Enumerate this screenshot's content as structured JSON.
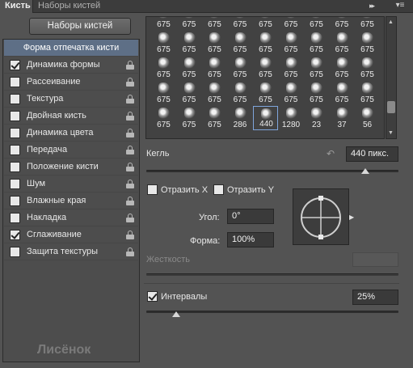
{
  "tabs": {
    "brush": "Кисть",
    "brush_sets": "Наборы кистей"
  },
  "collapse_glyph": "▸▸",
  "menu_glyph": "▾≡",
  "sets_button": "Наборы кистей",
  "left_panel": {
    "header": "Форма отпечатка кисти",
    "items": [
      {
        "label": "Динамика формы",
        "checked": true
      },
      {
        "label": "Рассеивание",
        "checked": false
      },
      {
        "label": "Текстура",
        "checked": false
      },
      {
        "label": "Двойная кисть",
        "checked": false
      },
      {
        "label": "Динамика цвета",
        "checked": false
      },
      {
        "label": "Передача",
        "checked": false
      },
      {
        "label": "Положение кисти",
        "checked": false
      },
      {
        "label": "Шум",
        "checked": false
      },
      {
        "label": "Влажные края",
        "checked": false
      },
      {
        "label": "Накладка",
        "checked": false
      },
      {
        "label": "Сглаживание",
        "checked": true
      },
      {
        "label": "Защита текстуры",
        "checked": false
      }
    ]
  },
  "watermark": "Лисёнок",
  "brush_grid": {
    "rows": [
      [
        "675",
        "675",
        "675",
        "675",
        "675",
        "675",
        "675",
        "675",
        "675"
      ],
      [
        "675",
        "675",
        "675",
        "675",
        "675",
        "675",
        "675",
        "675",
        "675"
      ],
      [
        "675",
        "675",
        "675",
        "675",
        "675",
        "675",
        "675",
        "675",
        "675"
      ],
      [
        "675",
        "675",
        "675",
        "675",
        "675",
        "675",
        "675",
        "675",
        "675"
      ],
      [
        "675",
        "675",
        "675",
        "286",
        "440",
        "1280",
        "23",
        "37",
        "56"
      ]
    ],
    "selected": "440"
  },
  "size": {
    "label": "Кегль",
    "value": "440 пикс.",
    "slider_fraction": 0.87
  },
  "flip_x": {
    "label": "Отразить X",
    "checked": false
  },
  "flip_y": {
    "label": "Отразить Y",
    "checked": false
  },
  "angle": {
    "label": "Угол:",
    "value": "0°"
  },
  "roundness": {
    "label": "Форма:",
    "value": "100%"
  },
  "hardness": {
    "label": "Жесткость",
    "disabled": true
  },
  "spacing": {
    "label": "Интервалы",
    "checked": true,
    "value": "25%",
    "slider_fraction": 0.12
  }
}
